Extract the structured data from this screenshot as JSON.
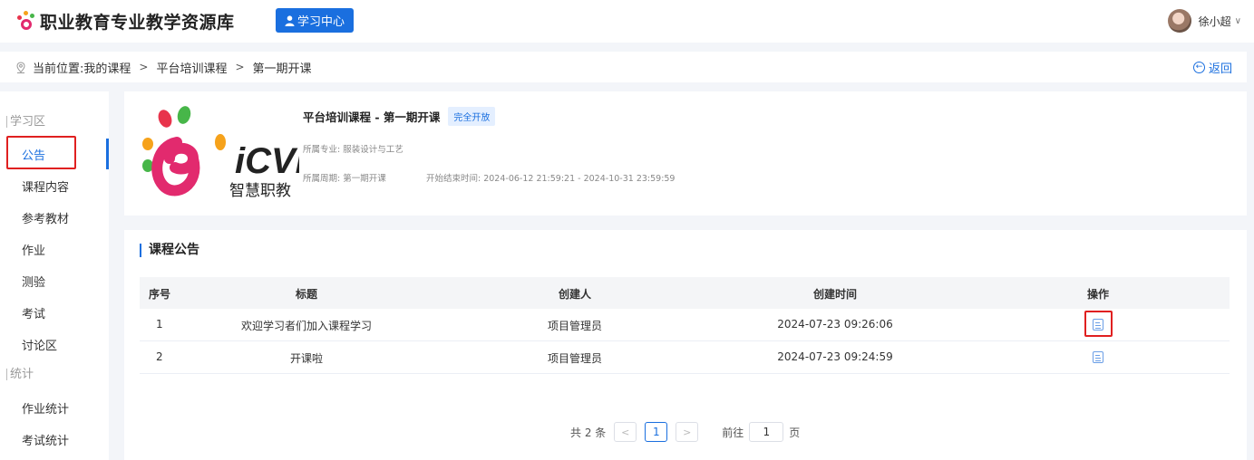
{
  "header": {
    "site_title": "职业教育专业教学资源库",
    "learning_center": "学习中心",
    "user_name": "徐小超",
    "user_menu_chevron": "∨"
  },
  "breadcrumb": {
    "prefix": "当前位置:",
    "items": [
      "我的课程",
      "平台培训课程",
      "第一期开课"
    ],
    "separator": ">",
    "back": "返回"
  },
  "sidebar": {
    "section_learning": "学习区",
    "learning_items": [
      "公告",
      "课程内容",
      "参考教材",
      "作业",
      "测验",
      "考试",
      "讨论区"
    ],
    "section_stats": "统计",
    "stats_items": [
      "作业统计",
      "考试统计"
    ]
  },
  "course": {
    "title": "平台培训课程 - 第一期开课",
    "status_badge": "完全开放",
    "major": "所属专业: 服装设计与工艺",
    "period": "所属周期: 第一期开课",
    "time_range": "开始结束时间: 2024-06-12 21:59:21 - 2024-10-31 23:59:59",
    "cover_text_main": "iCVE",
    "cover_text_sub": "智慧职教"
  },
  "announcements": {
    "section_title": "课程公告",
    "columns": [
      "序号",
      "标题",
      "创建人",
      "创建时间",
      "操作"
    ],
    "rows": [
      {
        "index": "1",
        "title": "欢迎学习者们加入课程学习",
        "creator": "项目管理员",
        "created": "2024-07-23 09:26:06",
        "action_icon": "view-document-icon"
      },
      {
        "index": "2",
        "title": "开课啦",
        "creator": "项目管理员",
        "created": "2024-07-23 09:24:59",
        "action_icon": "view-document-icon"
      }
    ]
  },
  "pagination": {
    "total": "共 2 条",
    "current_page": "1",
    "goto_label": "前往",
    "goto_value": "1",
    "page_suffix": "页"
  },
  "colors": {
    "accent": "#1a6fdf",
    "highlight": "#e02020",
    "background": "#f3f5f9"
  }
}
